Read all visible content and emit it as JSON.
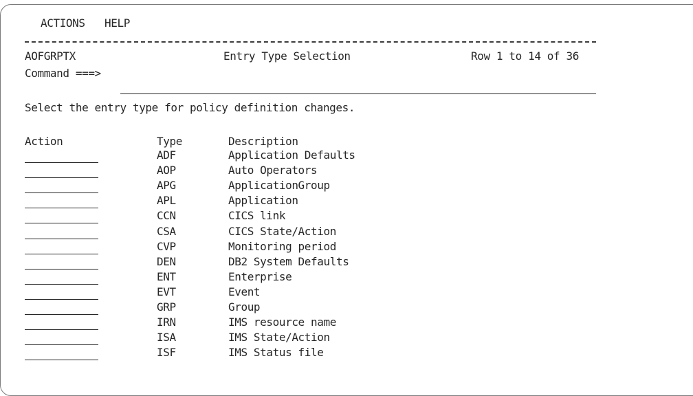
{
  "menu": {
    "actions": "ACTIONS",
    "help": "HELP"
  },
  "header": {
    "panel_id": "AOFGRPTX",
    "title": "Entry Type Selection",
    "row_info": "Row 1 to 14 of 36"
  },
  "command": {
    "label": "Command ===>",
    "value": ""
  },
  "instruction": "Select the entry type for policy definition changes.",
  "columns": {
    "action": "Action",
    "type": "Type",
    "description": "Description"
  },
  "rows": [
    {
      "type": "ADF",
      "description": "Application Defaults",
      "action": ""
    },
    {
      "type": "AOP",
      "description": "Auto Operators",
      "action": ""
    },
    {
      "type": "APG",
      "description": "ApplicationGroup",
      "action": ""
    },
    {
      "type": "APL",
      "description": "Application",
      "action": ""
    },
    {
      "type": "CCN",
      "description": "CICS link",
      "action": ""
    },
    {
      "type": "CSA",
      "description": "CICS State/Action",
      "action": ""
    },
    {
      "type": "CVP",
      "description": "Monitoring period",
      "action": ""
    },
    {
      "type": "DEN",
      "description": "DB2 System Defaults",
      "action": ""
    },
    {
      "type": "ENT",
      "description": "Enterprise",
      "action": ""
    },
    {
      "type": "EVT",
      "description": "Event",
      "action": ""
    },
    {
      "type": "GRP",
      "description": "Group",
      "action": ""
    },
    {
      "type": "IRN",
      "description": "IMS resource name",
      "action": ""
    },
    {
      "type": "ISA",
      "description": "IMS State/Action",
      "action": ""
    },
    {
      "type": "ISF",
      "description": "IMS Status file",
      "action": ""
    }
  ]
}
